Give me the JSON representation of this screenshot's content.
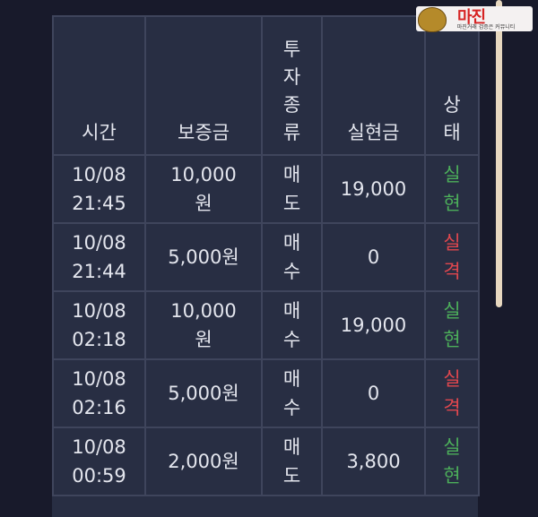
{
  "logo": {
    "text": "마진",
    "subtitle": "마진거래 검증은 커뮤니티"
  },
  "table": {
    "headers": {
      "time": "시간",
      "deposit": "보증금",
      "type": "투자종류",
      "realized": "실현금",
      "status": "상태"
    },
    "rows": [
      {
        "date": "10/08",
        "time": "21:45",
        "deposit": "10,000원",
        "type": "매도",
        "realized": "19,000",
        "status": "실현"
      },
      {
        "date": "10/08",
        "time": "21:44",
        "deposit": "5,000원",
        "type": "매수",
        "realized": "0",
        "status": "실격"
      },
      {
        "date": "10/08",
        "time": "02:18",
        "deposit": "10,000원",
        "type": "매수",
        "realized": "19,000",
        "status": "실현"
      },
      {
        "date": "10/08",
        "time": "02:16",
        "deposit": "5,000원",
        "type": "매수",
        "realized": "0",
        "status": "실격"
      },
      {
        "date": "10/08",
        "time": "00:59",
        "deposit": "2,000원",
        "type": "매도",
        "realized": "3,800",
        "status": "실현"
      }
    ]
  },
  "colors": {
    "background": "#181a2b",
    "panel": "#282e43",
    "success": "#4cae5a",
    "fail": "#e0474e"
  }
}
